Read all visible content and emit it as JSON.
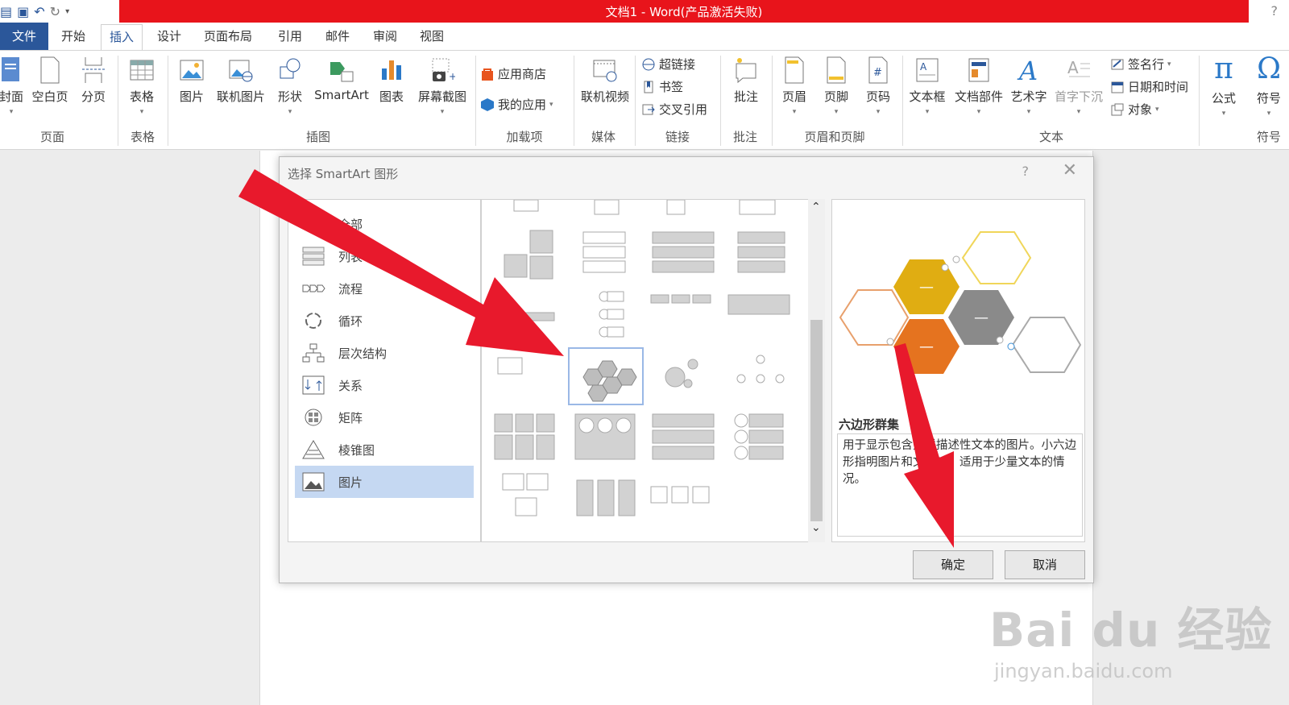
{
  "window": {
    "title": "文档1 -  Word(产品激活失败)",
    "help": "?"
  },
  "qat": {
    "undo_glyph": "↶",
    "redo_glyph": "↻",
    "more_glyph": "▾"
  },
  "tabs": [
    "文件",
    "开始",
    "插入",
    "设计",
    "页面布局",
    "引用",
    "邮件",
    "审阅",
    "视图"
  ],
  "ribbon": {
    "pages": {
      "cover": "封面",
      "blank": "空白页",
      "break": "分页",
      "group": "页面"
    },
    "table": {
      "table": "表格",
      "group": "表格"
    },
    "illustrations": {
      "picture": "图片",
      "online_picture": "联机图片",
      "shapes": "形状",
      "smartart": "SmartArt",
      "chart": "图表",
      "screenshot": "屏幕截图",
      "group": "插图"
    },
    "addins": {
      "store": "应用商店",
      "my_apps": "我的应用",
      "group": "加载项"
    },
    "media": {
      "online_video": "联机视频",
      "group": "媒体"
    },
    "links": {
      "hyperlink": "超链接",
      "bookmark": "书签",
      "cross_ref": "交叉引用",
      "group": "链接"
    },
    "comments": {
      "comment": "批注",
      "group": "批注"
    },
    "header_footer": {
      "header": "页眉",
      "footer": "页脚",
      "page_number": "页码",
      "group": "页眉和页脚"
    },
    "text": {
      "textbox": "文本框",
      "quick_parts": "文档部件",
      "wordart": "艺术字",
      "dropcap": "首字下沉",
      "signature": "签名行",
      "datetime": "日期和时间",
      "object": "对象",
      "group": "文本"
    },
    "symbols": {
      "equation": "公式",
      "symbol": "符号",
      "group": "符号",
      "pi": "π",
      "omega": "Ω"
    }
  },
  "dialog": {
    "title": "选择 SmartArt 图形",
    "help": "?",
    "close": "✕",
    "categories": [
      "全部",
      "列表",
      "流程",
      "循环",
      "层次结构",
      "关系",
      "矩阵",
      "棱锥图",
      "图片"
    ],
    "selected_category": "图片",
    "scroll_up": "⌃",
    "scroll_down": "⌄",
    "preview": {
      "name": "六边形群集",
      "description": "用于显示包含关联描述性文本的图片。小六边形指明图片和文本对。适用于少量文本的情况。",
      "dash": "—"
    },
    "ok": "确定",
    "cancel": "取消"
  },
  "watermark": {
    "brand": "Bai du 经验",
    "url": "jingyan.baidu.com"
  },
  "colors": {
    "title_red": "#e8141b",
    "accent_blue": "#2b579a",
    "arrow_red": "#e8192c",
    "selection_blue": "#c5d8f2"
  }
}
